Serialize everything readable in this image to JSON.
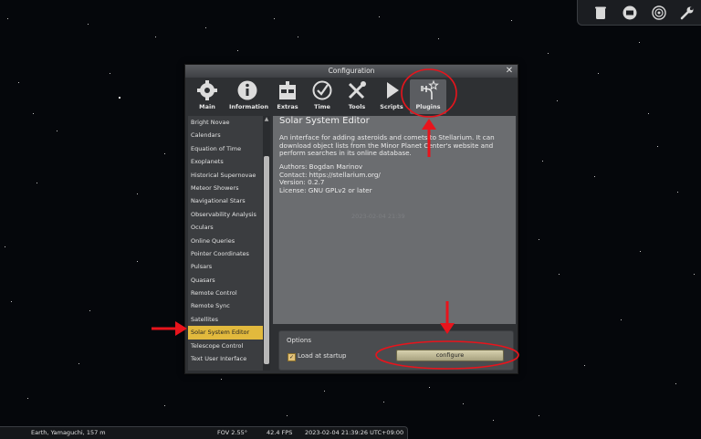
{
  "toolbar": {
    "icons": [
      "trash-icon",
      "screen-icon",
      "planet-icon",
      "wrench-icon"
    ]
  },
  "dialog": {
    "title": "Configuration",
    "close_glyph": "✕",
    "tabs": [
      {
        "label": "Main",
        "icon": "gear-icon"
      },
      {
        "label": "Information",
        "icon": "info-icon"
      },
      {
        "label": "Extras",
        "icon": "extras-icon"
      },
      {
        "label": "Time",
        "icon": "time-icon"
      },
      {
        "label": "Tools",
        "icon": "tools-icon"
      },
      {
        "label": "Scripts",
        "icon": "scripts-icon"
      },
      {
        "label": "Plugins",
        "icon": "plugins-icon",
        "active": true
      }
    ]
  },
  "plugins": {
    "items": [
      "Bright Novae",
      "Calendars",
      "Equation of Time",
      "Exoplanets",
      "Historical Supernovae",
      "Meteor Showers",
      "Navigational Stars",
      "Observability Analysis",
      "Oculars",
      "Online Queries",
      "Pointer Coordinates",
      "Pulsars",
      "Quasars",
      "Remote Control",
      "Remote Sync",
      "Satellites",
      "Solar System Editor",
      "Telescope Control",
      "Text User Interface"
    ],
    "selected": "Solar System Editor"
  },
  "detail": {
    "title": "Solar System Editor",
    "desc_line1": "An interface for adding asteroids and comets to Stellarium. It can",
    "desc_line2": "download object lists from the Minor Planet Center's website and",
    "desc_line3": "perform searches in its online database.",
    "authors": "Authors: Bogdan Marinov",
    "contact": "Contact: https://stellarium.org/",
    "version": "Version: 0.2.7",
    "license": "License: GNU GPLv2 or later",
    "watermark": "2023-02-04 21:39"
  },
  "options": {
    "title": "Options",
    "load_label": "Load at startup",
    "load_checked": true,
    "configure_label": "configure"
  },
  "status": {
    "location": "Earth, Yamaguchi, 157 m",
    "fov": "FOV 2.55°",
    "fps": "42.4 FPS",
    "datetime": "2023-02-04 21:39:26 UTC+09:00"
  },
  "colors": {
    "accent": "#e2b93d",
    "annotation": "#e8141c"
  }
}
